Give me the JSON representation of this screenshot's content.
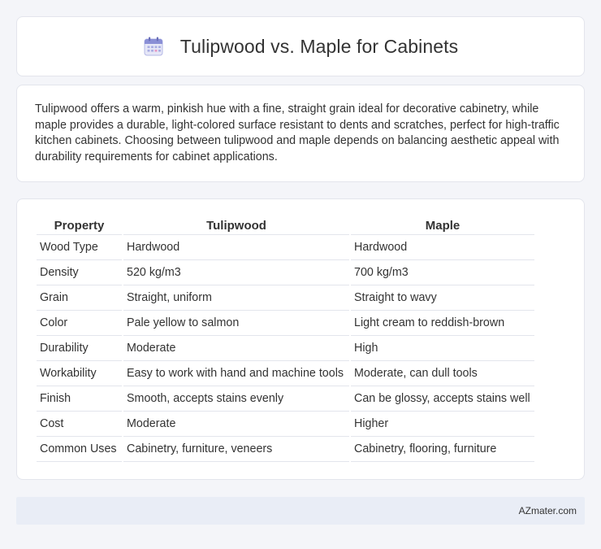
{
  "header": {
    "icon": "calendar-icon",
    "title": "Tulipwood vs. Maple for Cabinets"
  },
  "intro": {
    "text": "Tulipwood offers a warm, pinkish hue with a fine, straight grain ideal for decorative cabinetry, while maple provides a durable, light-colored surface resistant to dents and scratches, perfect for high-traffic kitchen cabinets. Choosing between tulipwood and maple depends on balancing aesthetic appeal with durability requirements for cabinet applications."
  },
  "table": {
    "headers": [
      "Property",
      "Tulipwood",
      "Maple"
    ],
    "rows": [
      [
        "Wood Type",
        "Hardwood",
        "Hardwood"
      ],
      [
        "Density",
        "520 kg/m3",
        "700 kg/m3"
      ],
      [
        "Grain",
        "Straight, uniform",
        "Straight to wavy"
      ],
      [
        "Color",
        "Pale yellow to salmon",
        "Light cream to reddish-brown"
      ],
      [
        "Durability",
        "Moderate",
        "High"
      ],
      [
        "Workability",
        "Easy to work with hand and machine tools",
        "Moderate, can dull tools"
      ],
      [
        "Finish",
        "Smooth, accepts stains evenly",
        "Can be glossy, accepts stains well"
      ],
      [
        "Cost",
        "Moderate",
        "Higher"
      ],
      [
        "Common Uses",
        "Cabinetry, furniture, veneers",
        "Cabinetry, flooring, furniture"
      ]
    ]
  },
  "footer": {
    "site": "AZmater.com"
  },
  "colors": {
    "background": "#f4f5f9",
    "card": "#ffffff",
    "footer": "#e9edf6",
    "icon_accent": "#8a8fd6"
  }
}
